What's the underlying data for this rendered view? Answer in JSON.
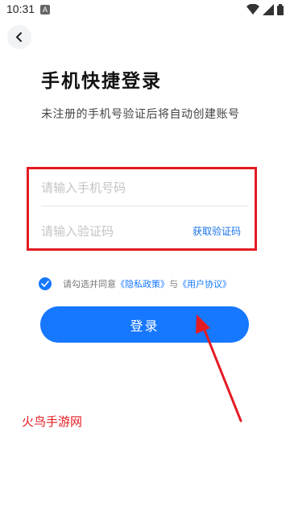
{
  "status_bar": {
    "time": "10:31",
    "notification_letter": "A"
  },
  "header": {
    "title": "手机快捷登录",
    "subtitle": "未注册的手机号验证后将自动创建账号"
  },
  "form": {
    "phone_placeholder": "请输入手机号码",
    "code_placeholder": "请输入验证码",
    "get_code_label": "获取验证码"
  },
  "agreement": {
    "prefix": "请勾选并同意",
    "privacy_link": "《隐私政策》",
    "joiner": "与",
    "user_link": "《用户协议》",
    "checked": true
  },
  "login_button_label": "登录",
  "watermark": "火鸟手游网",
  "colors": {
    "accent": "#1677ff",
    "highlight_red": "#e41b23"
  },
  "icons": [
    "back-chevron-icon",
    "wifi-icon",
    "cellular-signal-icon",
    "battery-icon",
    "check-icon"
  ]
}
